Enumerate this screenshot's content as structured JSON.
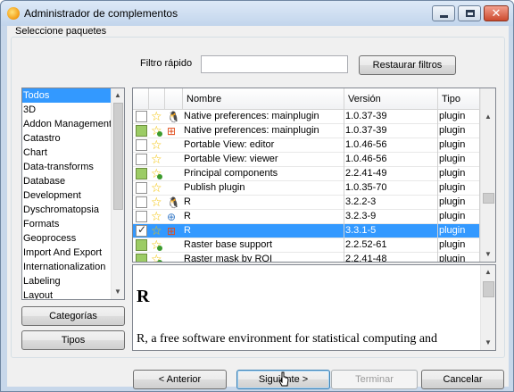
{
  "window": {
    "title": "Administrador de complementos"
  },
  "select_section": {
    "label": "Seleccione paquetes"
  },
  "filter": {
    "label": "Filtro rápido",
    "value": "",
    "reset_label": "Restaurar filtros"
  },
  "categories": {
    "items": [
      "Todos",
      "3D",
      "Addon Management",
      "Catastro",
      "Chart",
      "Data-transforms",
      "Database",
      "Development",
      "Dyschromatopsia",
      "Formats",
      "Geoprocess",
      "Import And Export",
      "Internationalization",
      "Labeling",
      "Layout"
    ],
    "selected": "Todos",
    "categories_button": "Categorías",
    "types_button": "Tipos"
  },
  "packages": {
    "columns": [
      "Nombre",
      "Versión",
      "Tipo"
    ],
    "rows": [
      {
        "name": "Native preferences: mainplugin",
        "version": "1.0.37-39",
        "type": "plugin",
        "installed": false,
        "checked": false,
        "os": "linux",
        "selected": false
      },
      {
        "name": "Native preferences: mainplugin",
        "version": "1.0.37-39",
        "type": "plugin",
        "installed": true,
        "checked": false,
        "os": "windows",
        "selected": false
      },
      {
        "name": "Portable View: editor",
        "version": "1.0.46-56",
        "type": "plugin",
        "installed": false,
        "checked": false,
        "os": "",
        "selected": false
      },
      {
        "name": "Portable View: viewer",
        "version": "1.0.46-56",
        "type": "plugin",
        "installed": false,
        "checked": false,
        "os": "",
        "selected": false
      },
      {
        "name": "Principal components",
        "version": "2.2.41-49",
        "type": "plugin",
        "installed": true,
        "checked": false,
        "os": "",
        "selected": false
      },
      {
        "name": "Publish plugin",
        "version": "1.0.35-70",
        "type": "plugin",
        "installed": false,
        "checked": false,
        "os": "",
        "selected": false
      },
      {
        "name": "R",
        "version": "3.2.2-3",
        "type": "plugin",
        "installed": false,
        "checked": false,
        "os": "linux",
        "selected": false
      },
      {
        "name": "R",
        "version": "3.2.3-9",
        "type": "plugin",
        "installed": false,
        "checked": false,
        "os": "multi",
        "selected": false
      },
      {
        "name": "R",
        "version": "3.3.1-5",
        "type": "plugin",
        "installed": false,
        "checked": true,
        "os": "windows",
        "selected": true
      },
      {
        "name": "Raster base support",
        "version": "2.2.52-61",
        "type": "plugin",
        "installed": true,
        "checked": false,
        "os": "",
        "selected": false
      },
      {
        "name": "Raster mask by ROI",
        "version": "2.2.41-48",
        "type": "plugin",
        "installed": true,
        "checked": false,
        "os": "",
        "selected": false
      }
    ]
  },
  "description": {
    "title": "R",
    "text": "R, a free software environment for statistical computing and"
  },
  "footer": {
    "prev": "< Anterior",
    "next": "Siguiente >",
    "finish": "Terminar",
    "cancel": "Cancelar"
  },
  "colors": {
    "selection": "#3399ff",
    "installed": "#9ccc65",
    "titlebar": "#c7d7ea"
  }
}
